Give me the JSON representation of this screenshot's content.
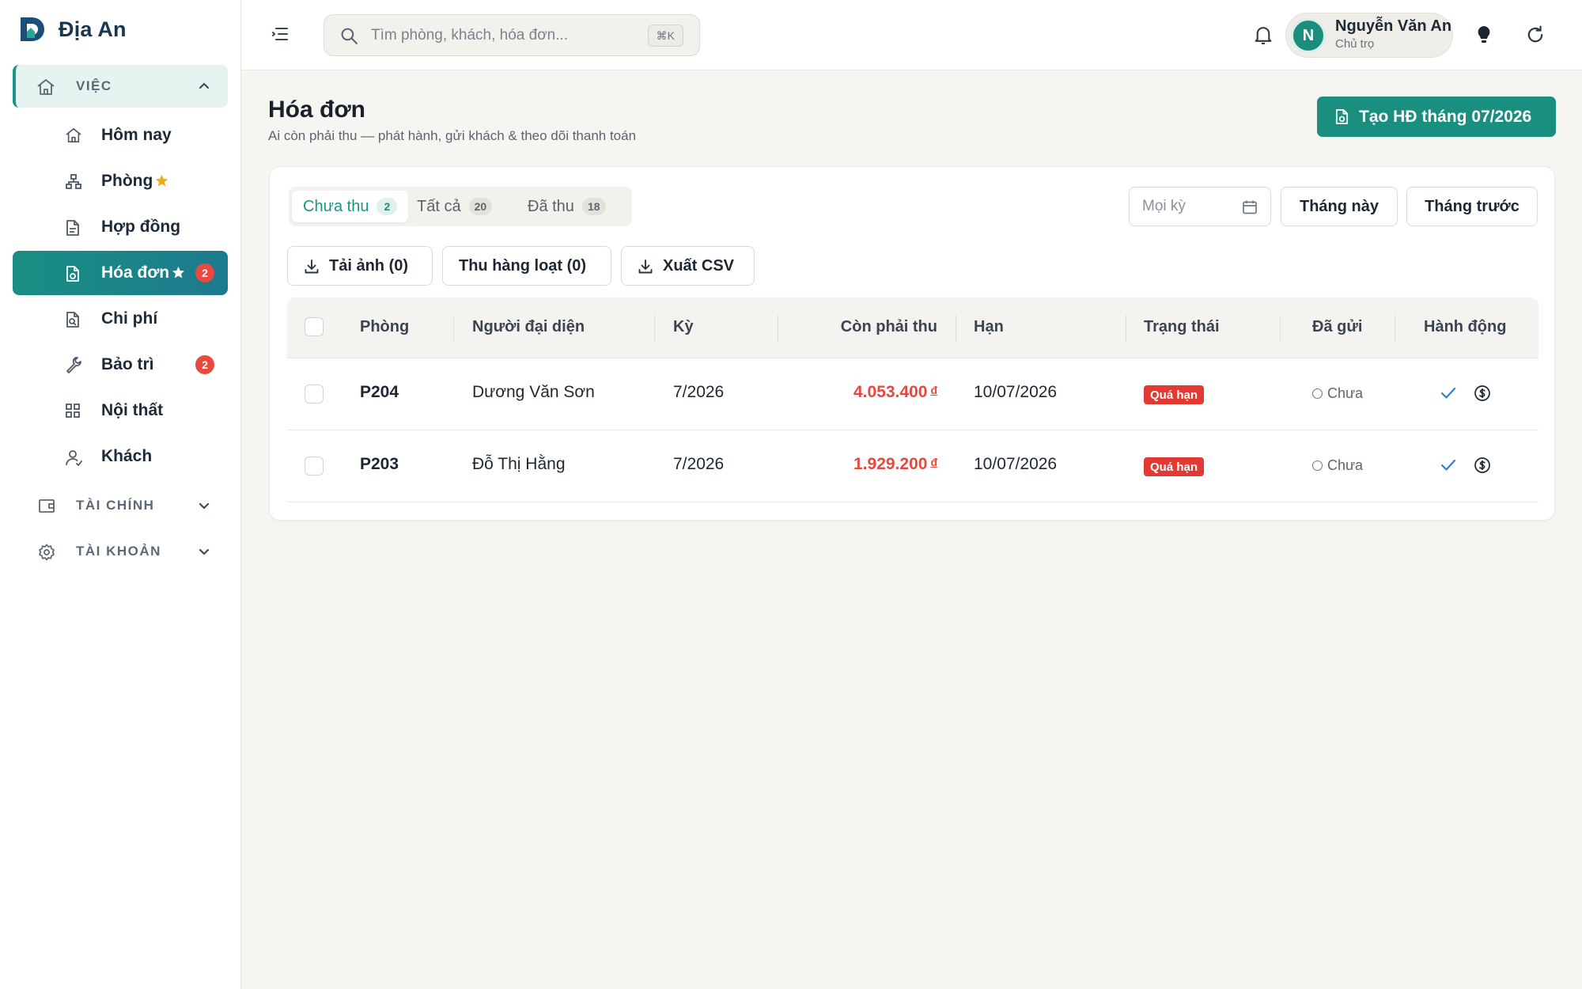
{
  "brand": {
    "name": "Địa An",
    "accent": "#1a8f80"
  },
  "sidebar": {
    "groups": [
      {
        "label": "VIỆC",
        "icon": "home-icon"
      },
      {
        "label": "TÀI CHÍNH",
        "icon": "wallet-icon"
      },
      {
        "label": "TÀI KHOẢN",
        "icon": "gear-icon"
      }
    ],
    "items": [
      {
        "label": "Hôm nay",
        "icon": "home-icon"
      },
      {
        "label": "Phòng",
        "icon": "rooms-icon",
        "starred": true
      },
      {
        "label": "Hợp đồng",
        "icon": "contract-icon"
      },
      {
        "label": "Hóa đơn",
        "icon": "invoice-icon",
        "starred": true,
        "badge": "2",
        "active": true
      },
      {
        "label": "Chi phí",
        "icon": "expense-icon"
      },
      {
        "label": "Bảo trì",
        "icon": "wrench-icon",
        "badge": "2"
      },
      {
        "label": "Nội thất",
        "icon": "grid-icon"
      },
      {
        "label": "Khách",
        "icon": "guest-icon"
      }
    ]
  },
  "topbar": {
    "search_placeholder": "Tìm phòng, khách, hóa đơn...",
    "search_shortcut": "⌘K",
    "user": {
      "initial": "N",
      "name": "Nguyễn Văn An",
      "role": "Chủ trọ"
    }
  },
  "page": {
    "title": "Hóa đơn",
    "subtitle": "Ai còn phải thu — phát hành, gửi khách & theo dõi thanh toán",
    "create_button": "Tạo HĐ tháng 07/2026"
  },
  "filters": {
    "tabs": [
      {
        "label": "Chưa thu",
        "count": "2",
        "active": true
      },
      {
        "label": "Tất cả",
        "count": "20"
      },
      {
        "label": "Đã thu",
        "count": "18"
      }
    ],
    "period_placeholder": "Mọi kỳ",
    "this_month": "Tháng này",
    "last_month": "Tháng trước"
  },
  "actions": {
    "download_images": "Tải ảnh (0)",
    "bulk_collect": "Thu hàng loạt (0)",
    "export_csv": "Xuất CSV"
  },
  "table": {
    "headers": {
      "room": "Phòng",
      "representative": "Người đại diện",
      "period": "Kỳ",
      "remaining": "Còn phải thu",
      "due": "Hạn",
      "status": "Trạng thái",
      "sent": "Đã gửi",
      "actions": "Hành động"
    },
    "rows": [
      {
        "room": "P204",
        "representative": "Dương Văn Sơn",
        "period": "7/2026",
        "remaining": "4.053.400",
        "currency": "đ",
        "due": "10/07/2026",
        "status": "Quá hạn",
        "sent": "Chưa"
      },
      {
        "room": "P203",
        "representative": "Đỗ Thị Hằng",
        "period": "7/2026",
        "remaining": "1.929.200",
        "currency": "đ",
        "due": "10/07/2026",
        "status": "Quá hạn",
        "sent": "Chưa"
      }
    ]
  },
  "colors": {
    "overdue": "#e23a32",
    "amount": "#e5483e",
    "badge": "#e84a3f",
    "star": "#f0a81c",
    "check": "#2f80d6"
  }
}
